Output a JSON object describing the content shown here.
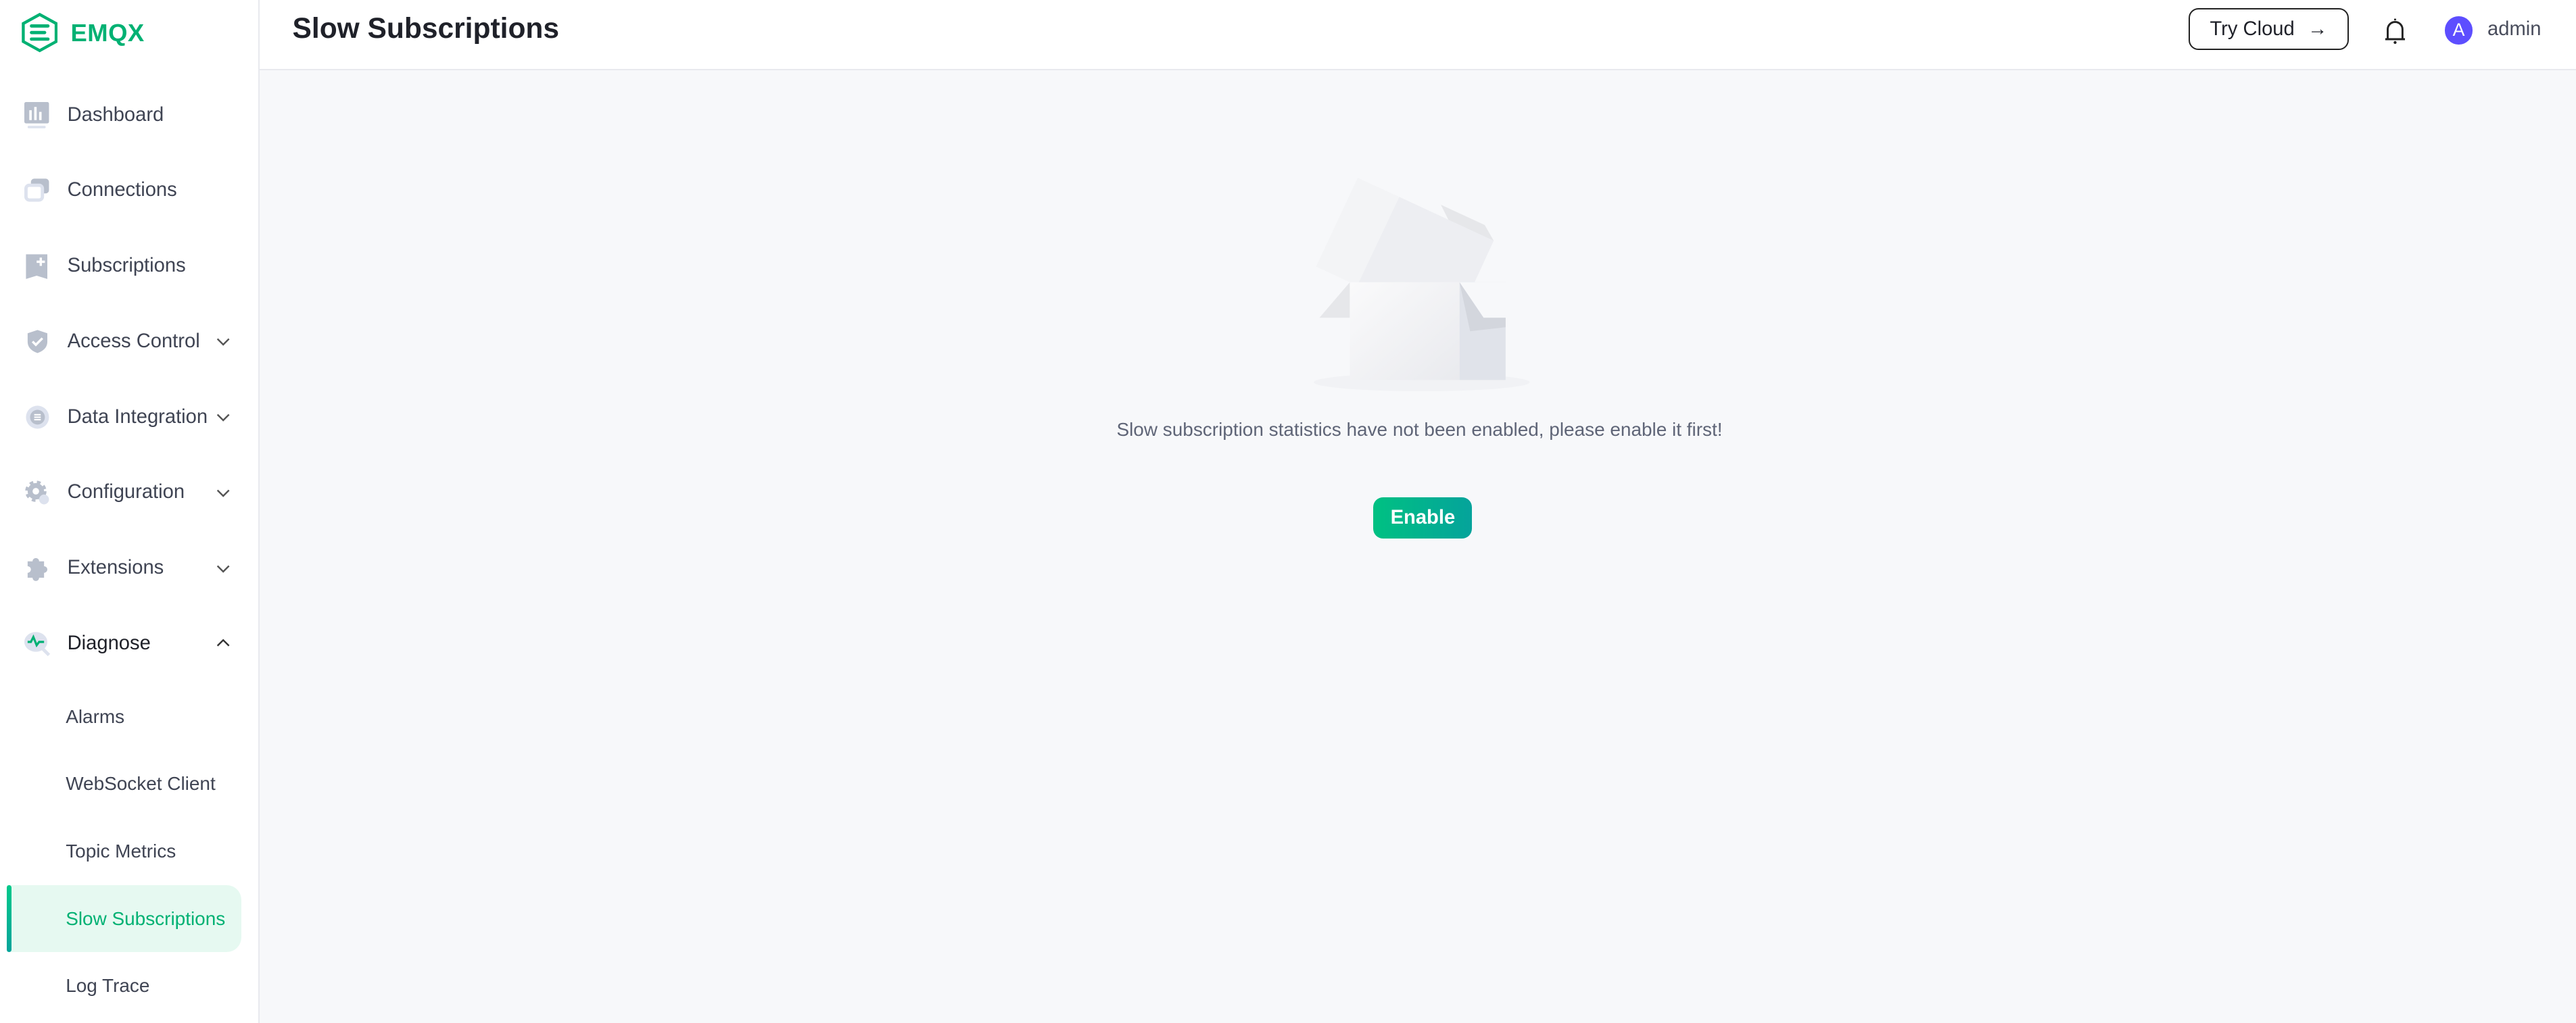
{
  "app": {
    "name": "EMQX",
    "brand_color": "#00b173"
  },
  "sidebar": {
    "items": [
      {
        "label": "Dashboard",
        "icon": "dashboard-icon"
      },
      {
        "label": "Connections",
        "icon": "connections-icon"
      },
      {
        "label": "Subscriptions",
        "icon": "subscriptions-icon"
      },
      {
        "label": "Access Control",
        "icon": "shield-icon",
        "expandable": true
      },
      {
        "label": "Data Integration",
        "icon": "data-integration-icon",
        "expandable": true
      },
      {
        "label": "Configuration",
        "icon": "gear-icon",
        "expandable": true
      },
      {
        "label": "Extensions",
        "icon": "puzzle-icon",
        "expandable": true
      },
      {
        "label": "Diagnose",
        "icon": "diagnose-icon",
        "expandable": true,
        "expanded": true
      }
    ],
    "diagnose_children": [
      {
        "label": "Alarms"
      },
      {
        "label": "WebSocket Client"
      },
      {
        "label": "Topic Metrics"
      },
      {
        "label": "Slow Subscriptions",
        "active": true
      },
      {
        "label": "Log Trace"
      }
    ]
  },
  "header": {
    "title": "Slow Subscriptions",
    "try_cloud_label": "Try Cloud",
    "avatar_letter": "A",
    "username": "admin",
    "avatar_color": "#5d4eff"
  },
  "main": {
    "empty_message": "Slow subscription statistics have not been enabled, please enable it first!",
    "enable_label": "Enable"
  }
}
